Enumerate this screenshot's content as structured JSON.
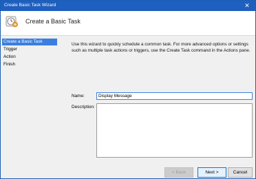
{
  "window": {
    "title": "Create Basic Task Wizard",
    "close_glyph": "✕"
  },
  "header": {
    "heading": "Create a Basic Task",
    "icon": "task-scheduler-icon"
  },
  "steps": [
    {
      "label": "Create a Basic Task",
      "active": true
    },
    {
      "label": "Trigger",
      "active": false
    },
    {
      "label": "Action",
      "active": false
    },
    {
      "label": "Finish",
      "active": false
    }
  ],
  "content": {
    "intro": "Use this wizard to quickly schedule a common task.  For more advanced options or settings such as multiple task actions or triggers, use the Create Task command in the Actions pane.",
    "name_label": "Name:",
    "name_value": "Display Message",
    "description_label": "Description:",
    "description_value": ""
  },
  "footer": {
    "back_label": "< Back",
    "next_label": "Next >",
    "cancel_label": "Cancel"
  },
  "colors": {
    "titlebar": "#1f5fbf",
    "selection": "#3b7ee0"
  }
}
